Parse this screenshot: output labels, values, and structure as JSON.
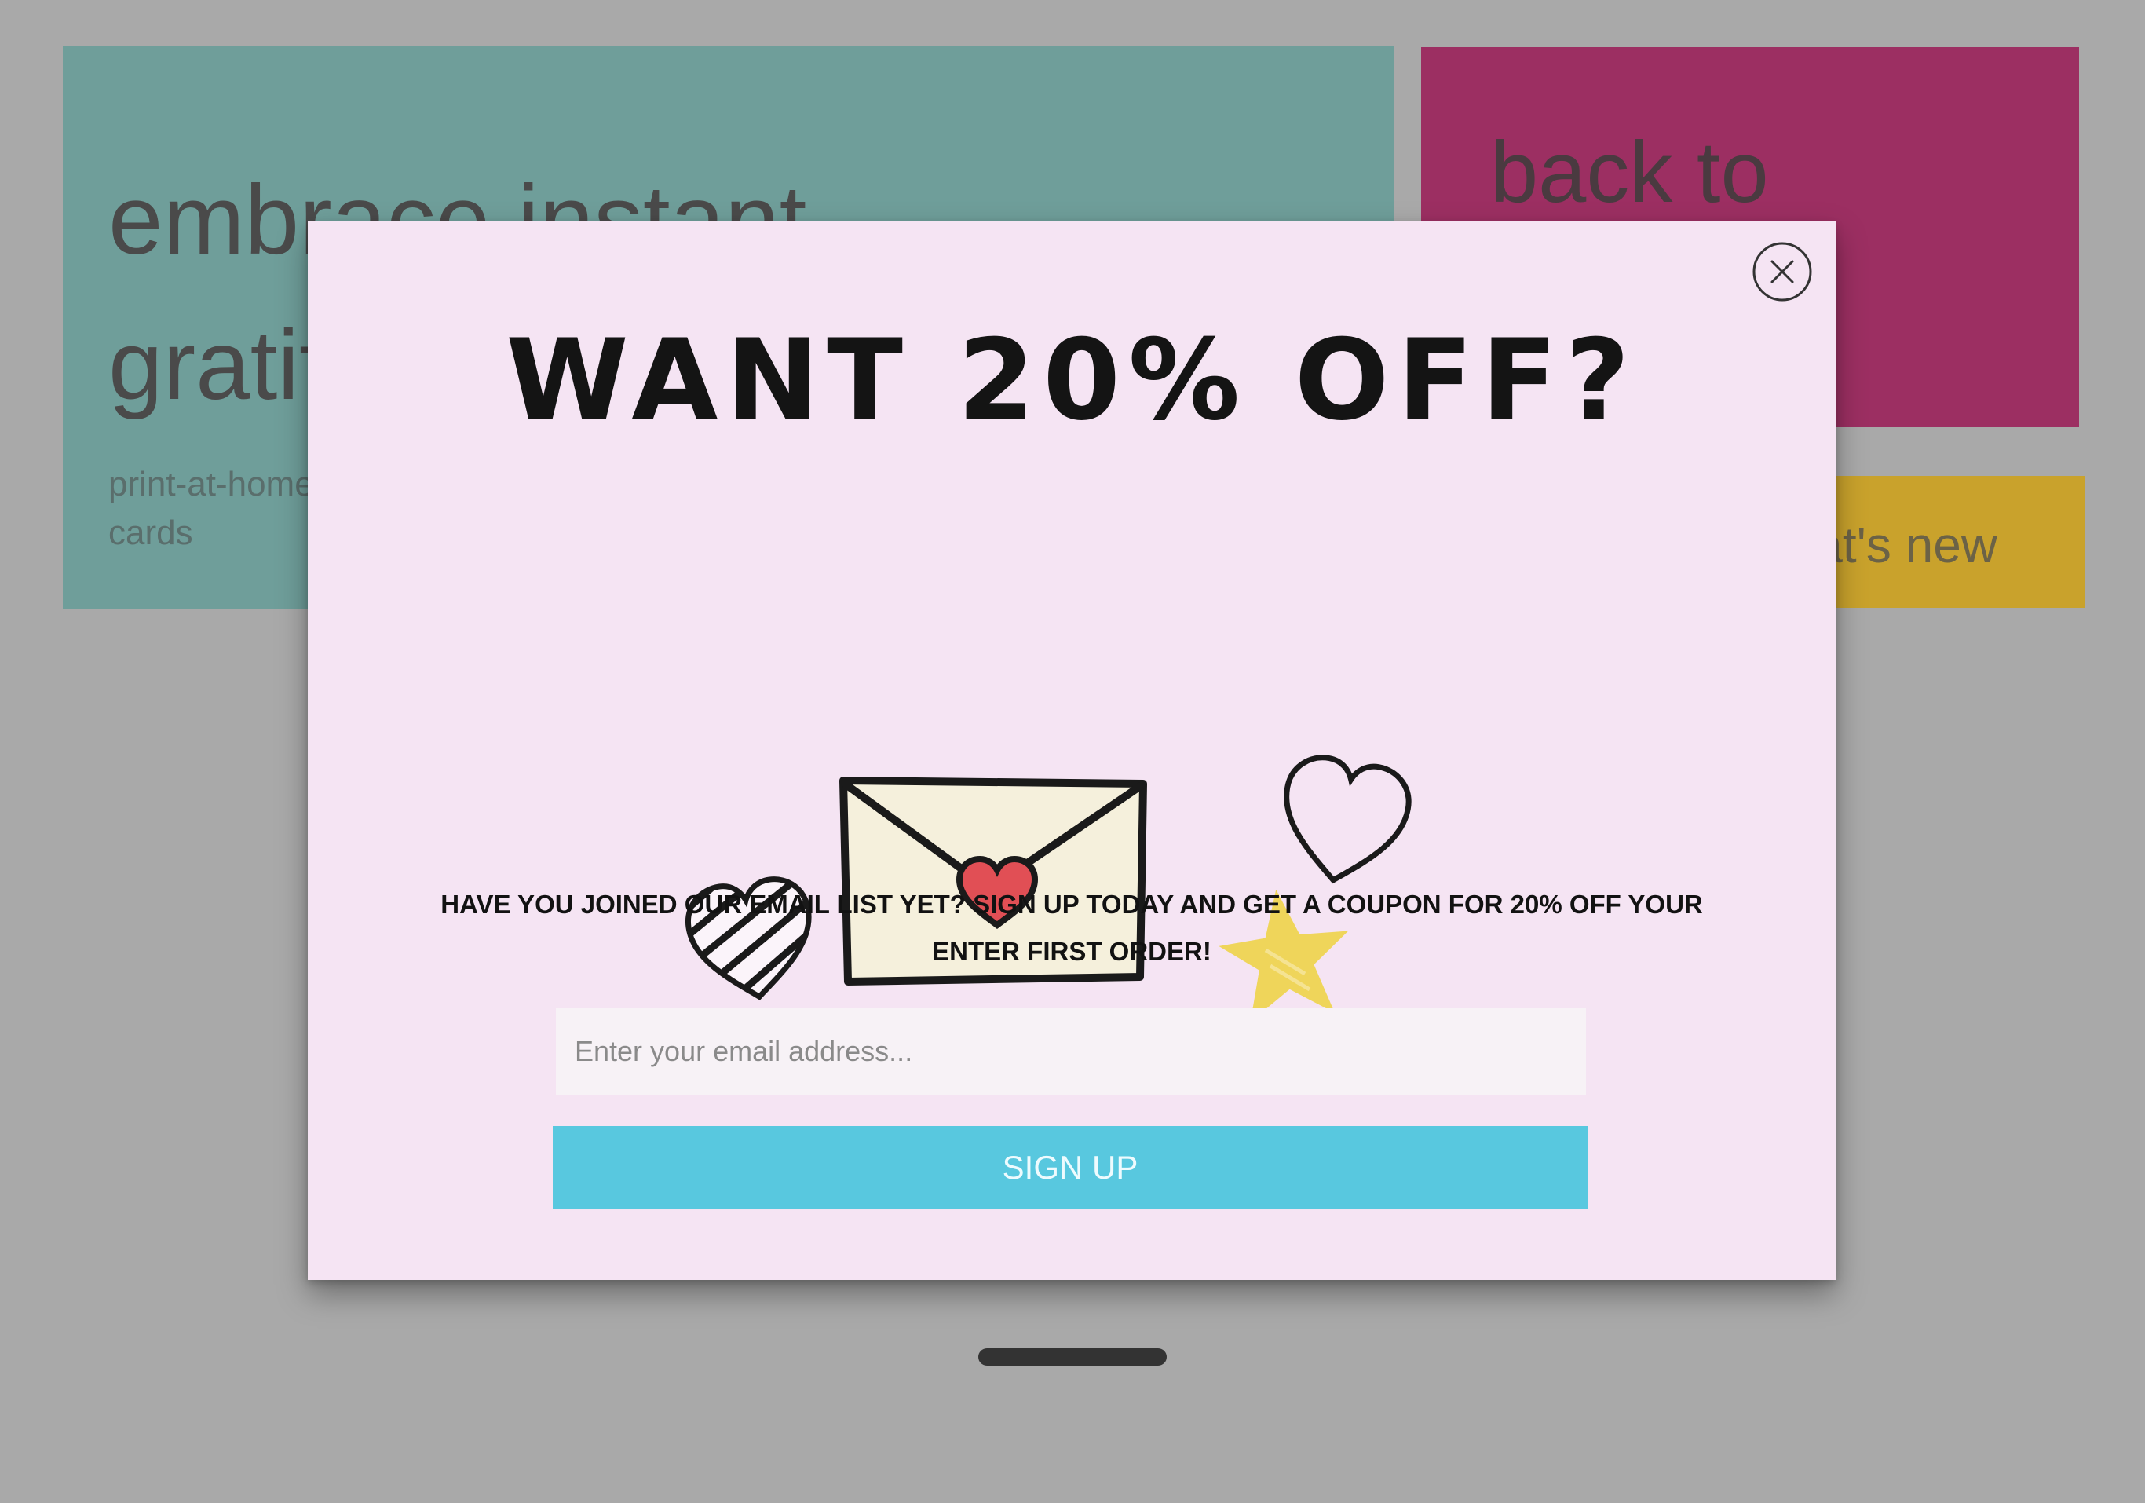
{
  "background": {
    "teal_tile": {
      "headline": "embrace instant gratification",
      "subtext": "print-at-home greeting cards"
    },
    "magenta_tile": {
      "headline": "back to"
    },
    "gold_tile": {
      "text": "what's new"
    },
    "colors": {
      "page": "#a9a9a9",
      "teal": "#6f9e9a",
      "magenta": "#9c2f62",
      "gold": "#c9a22c"
    }
  },
  "modal": {
    "title": "WANT 20% OFF?",
    "body_line1": "HAVE YOU JOINED OUR EMAIL LIST YET? SIGN UP TODAY AND GET A COUPON FOR 20% OFF YOUR",
    "body_line2": "ENTER FIRST ORDER!",
    "email_placeholder": "Enter your email address...",
    "signup_label": "SIGN UP",
    "close_icon": "close-circle-icon",
    "illustration_icons": [
      "striped-heart-icon",
      "envelope-heart-icon",
      "outline-heart-icon",
      "star-icon"
    ],
    "colors": {
      "background": "#f5e4f3",
      "button": "#58c8df",
      "heart_seal": "#e14f55",
      "star": "#efd55a",
      "envelope": "#f5f0dc"
    }
  }
}
